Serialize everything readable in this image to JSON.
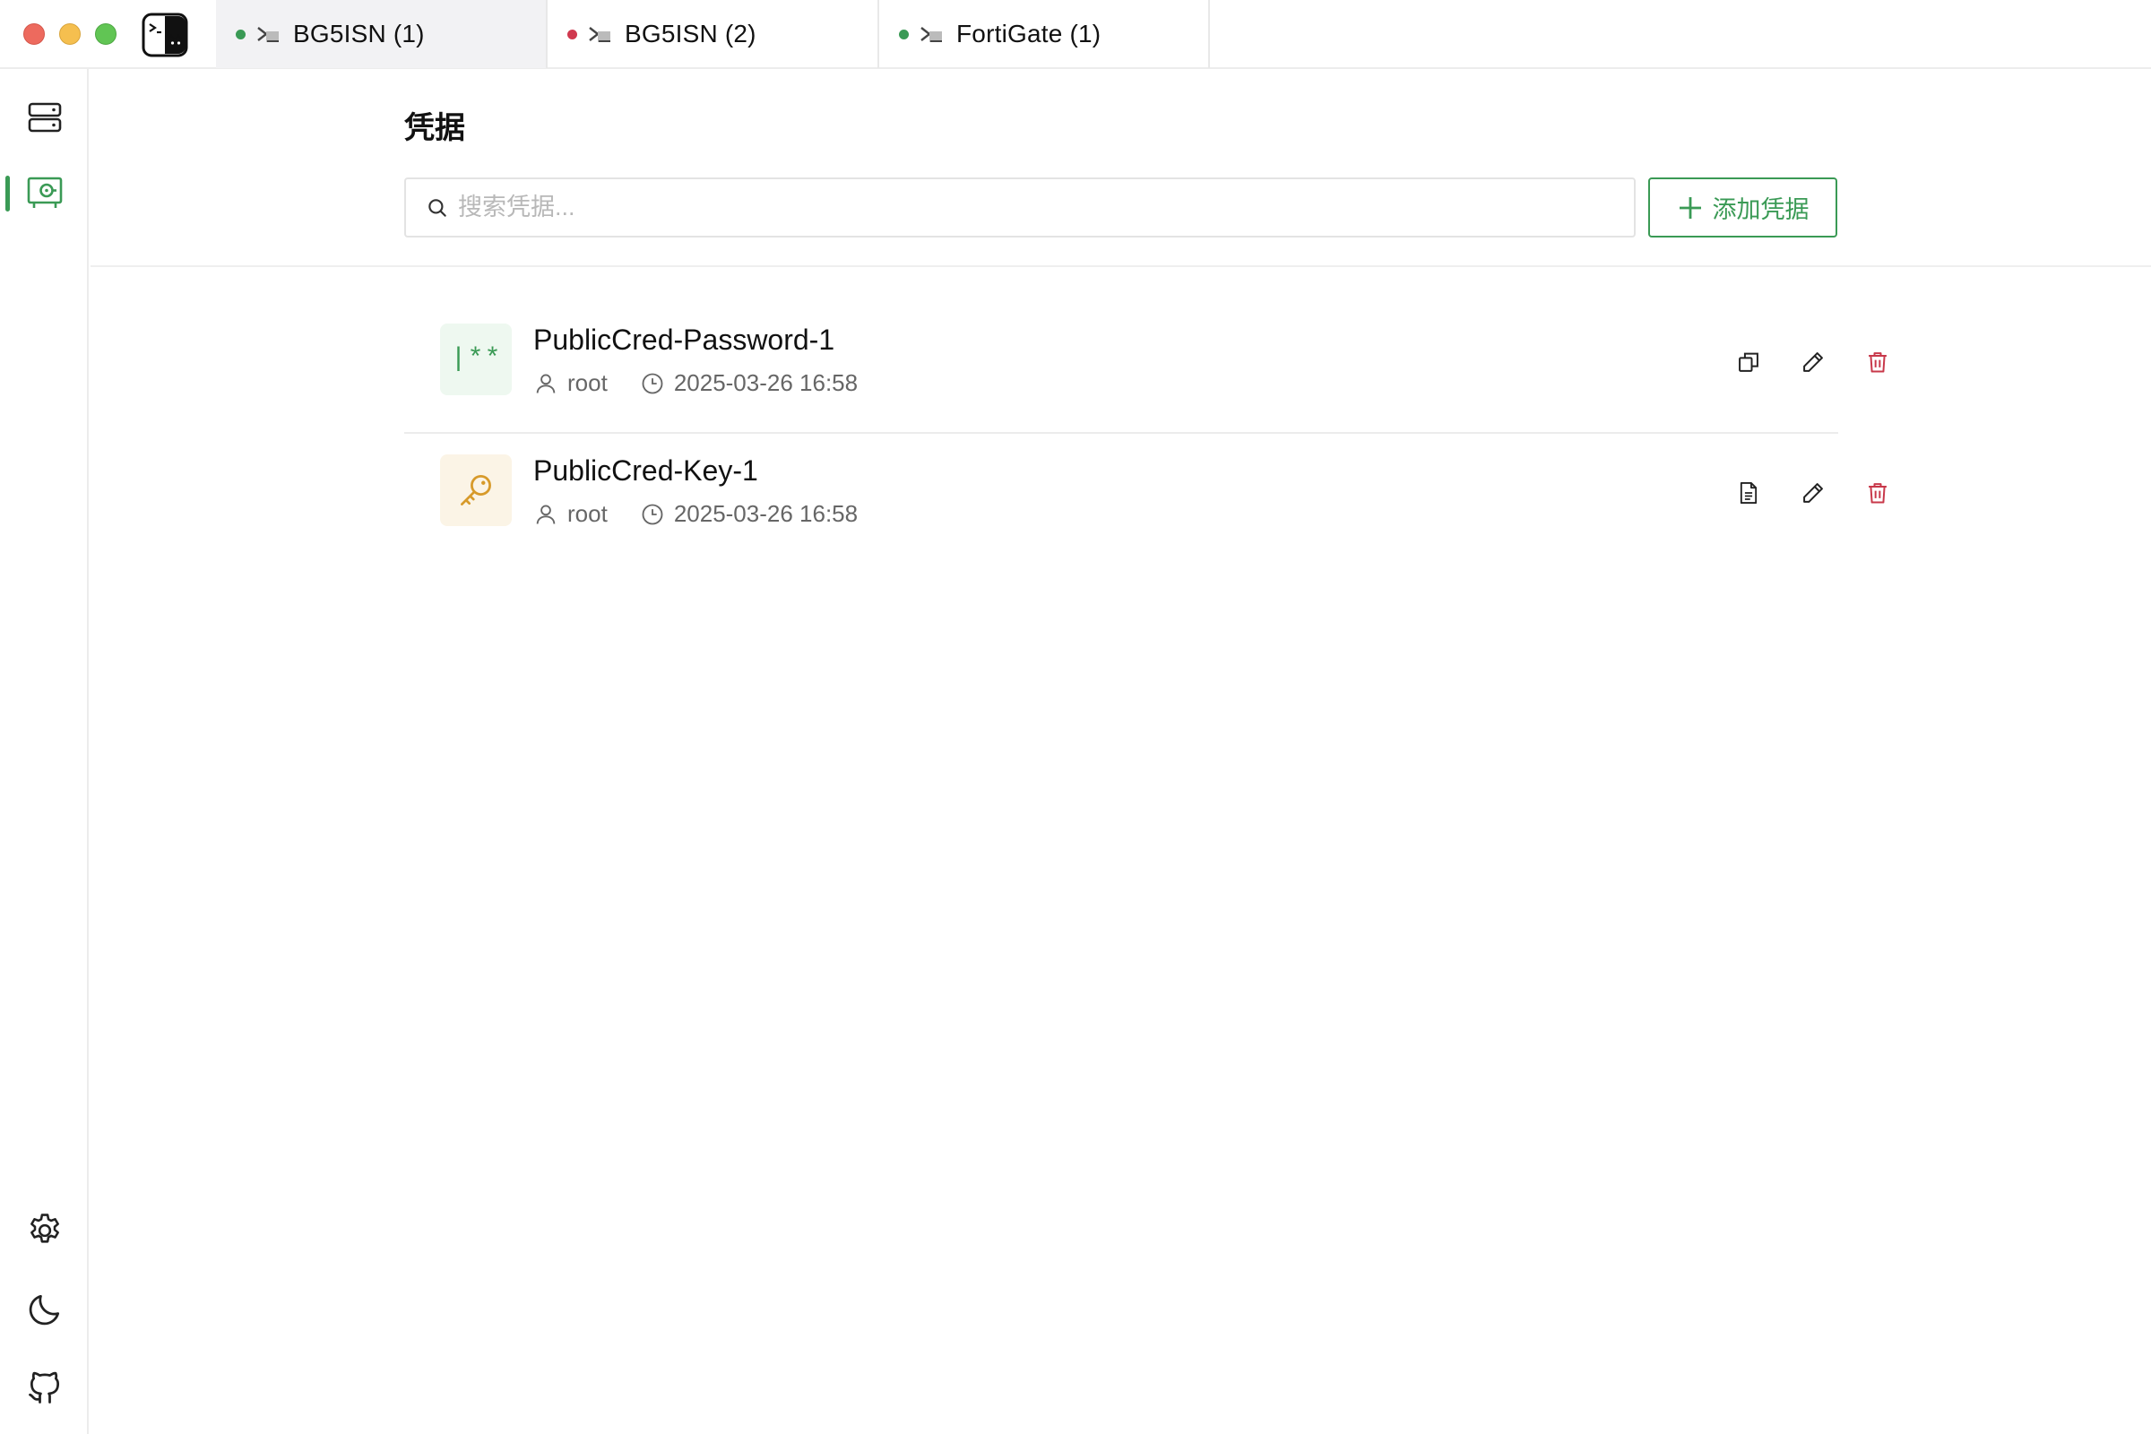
{
  "tabs": [
    {
      "label": "BG5ISN (1)",
      "status_color": "#3a9a55",
      "active": true
    },
    {
      "label": "BG5ISN (2)",
      "status_color": "#d0394f",
      "active": false
    },
    {
      "label": "FortiGate (1)",
      "status_color": "#3a9a55",
      "active": false
    }
  ],
  "sidebar": {
    "top_items": [
      {
        "icon": "server-icon",
        "active": false
      },
      {
        "icon": "vault-icon",
        "active": true
      }
    ],
    "bottom_items": [
      {
        "icon": "gear-icon"
      },
      {
        "icon": "moon-icon"
      },
      {
        "icon": "github-icon"
      }
    ]
  },
  "page": {
    "title": "凭据",
    "search_placeholder": "搜索凭据...",
    "add_button_label": "添加凭据"
  },
  "credentials": [
    {
      "name": "PublicCred-Password-1",
      "type": "password",
      "icon_text": "|**",
      "user": "root",
      "time": "2025-03-26 16:58",
      "actions": [
        "copy-icon",
        "edit-icon",
        "delete-icon"
      ]
    },
    {
      "name": "PublicCred-Key-1",
      "type": "key",
      "user": "root",
      "time": "2025-03-26 16:58",
      "actions": [
        "file-icon",
        "edit-icon",
        "delete-icon"
      ]
    }
  ],
  "colors": {
    "accent": "#3a9a55",
    "danger": "#c8384a",
    "key_icon": "#d79a2a"
  }
}
